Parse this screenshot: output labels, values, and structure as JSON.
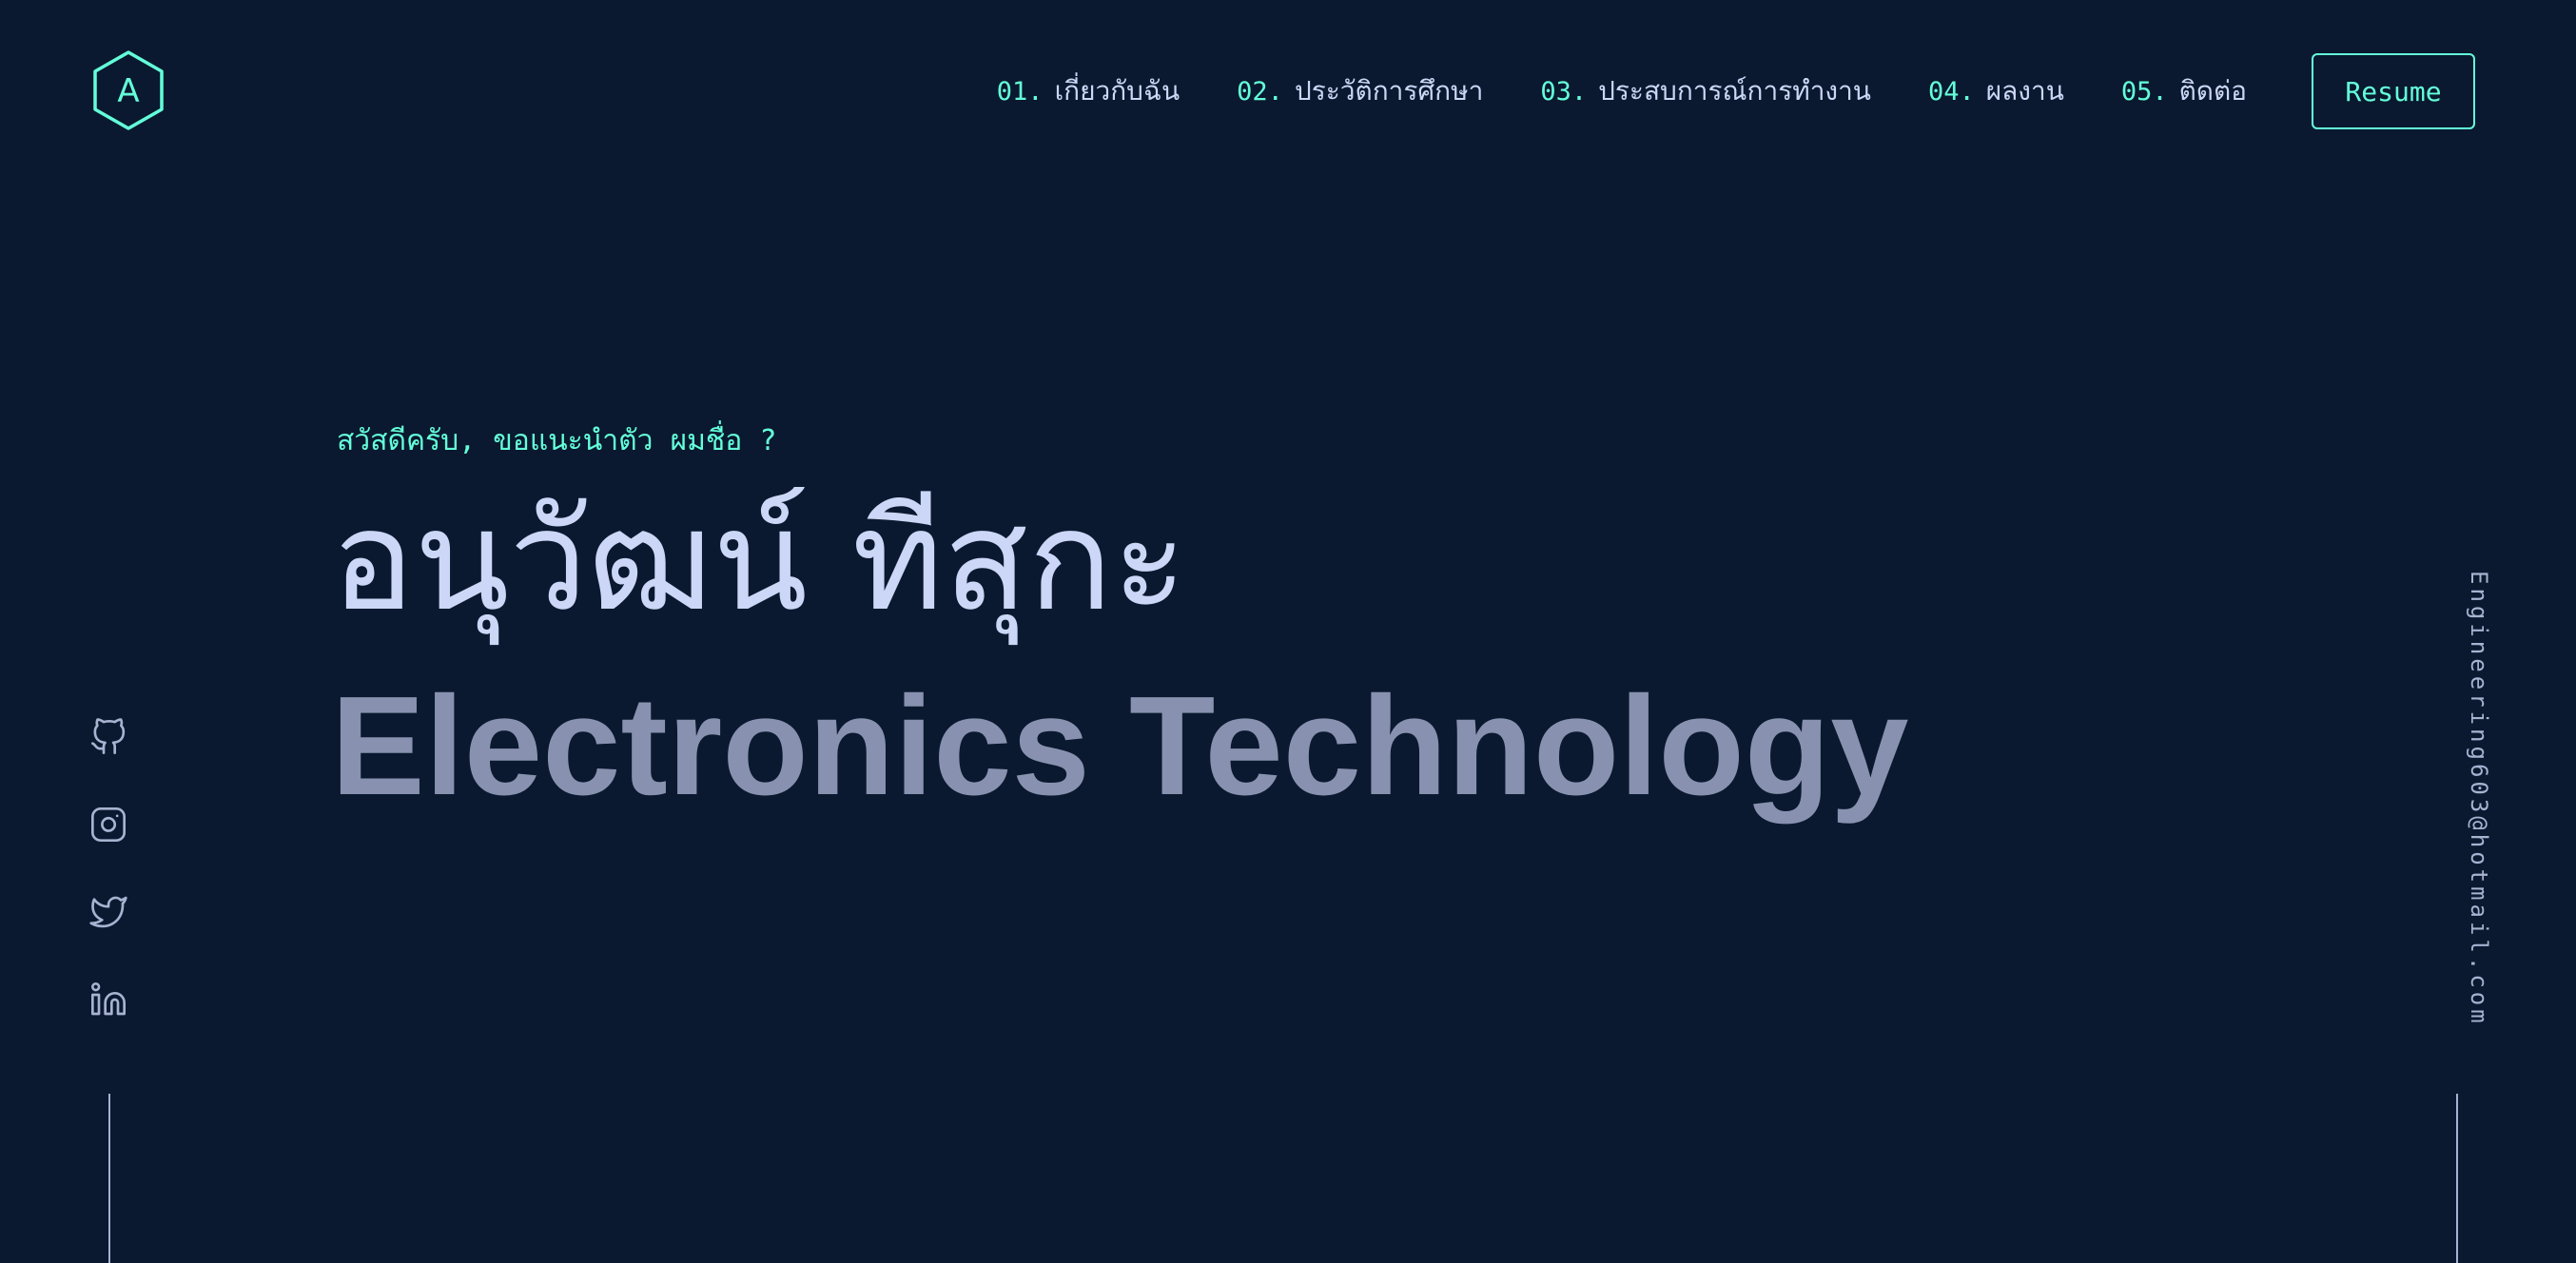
{
  "header": {
    "logo_letter": "A",
    "nav": [
      {
        "num": "01.",
        "label": "เกี่ยวกับฉัน"
      },
      {
        "num": "02.",
        "label": "ประวัติการศึกษา"
      },
      {
        "num": "03.",
        "label": "ประสบการณ์การทำงาน"
      },
      {
        "num": "04.",
        "label": "ผลงาน"
      },
      {
        "num": "05.",
        "label": "ติดต่อ"
      }
    ],
    "resume_label": "Resume"
  },
  "hero": {
    "intro": "สวัสดีครับ, ขอแนะนำตัว ผมชื่อ ?",
    "name": "อนุวัฒน์ ทีสุกะ",
    "tagline": "Electronics Technology"
  },
  "socials": [
    {
      "icon": "github-icon"
    },
    {
      "icon": "instagram-icon"
    },
    {
      "icon": "twitter-icon"
    },
    {
      "icon": "linkedin-icon"
    }
  ],
  "email": "Engineering603@hotmail.com",
  "colors": {
    "background": "#0a192f",
    "accent": "#64ffda",
    "heading": "#ccd6f6",
    "muted": "#8892b0"
  }
}
